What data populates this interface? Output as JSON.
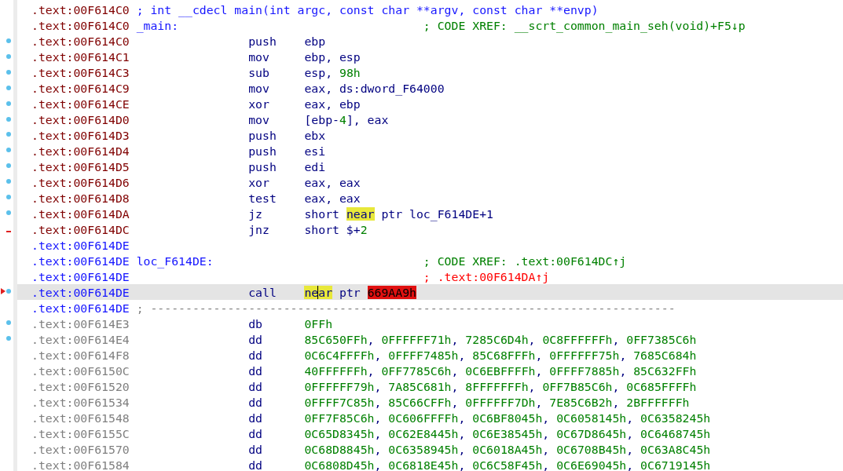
{
  "lines": [
    {
      "address": ".text:00F614C0",
      "kind": "code",
      "selected": false,
      "comment": {
        "text": "; int __cdecl main(int argc, const char **argv, const char **envp)",
        "kind": "prototype"
      }
    },
    {
      "address": ".text:00F614C0",
      "kind": "code",
      "selected": false,
      "label": "_main:",
      "comment": {
        "text": "; CODE XREF: __scrt_common_main_seh(void)+F5↓p",
        "kind": "xref"
      }
    },
    {
      "address": ".text:00F614C0",
      "kind": "code",
      "gutter": {
        "kind": "dot"
      },
      "selected": false,
      "mnemonic": "push",
      "operands": [
        {
          "text": "ebp",
          "kind": "plain"
        }
      ]
    },
    {
      "address": ".text:00F614C1",
      "kind": "code",
      "gutter": {
        "kind": "dot"
      },
      "selected": false,
      "mnemonic": "mov",
      "operands": [
        {
          "text": "ebp, esp",
          "kind": "plain"
        }
      ]
    },
    {
      "address": ".text:00F614C3",
      "kind": "code",
      "gutter": {
        "kind": "dot"
      },
      "selected": false,
      "mnemonic": "sub",
      "operands": [
        {
          "text": "esp, ",
          "kind": "plain"
        },
        {
          "text": "98h",
          "kind": "number"
        }
      ]
    },
    {
      "address": ".text:00F614C9",
      "kind": "code",
      "gutter": {
        "kind": "dot"
      },
      "selected": false,
      "mnemonic": "mov",
      "operands": [
        {
          "text": "eax, ds:dword_F64000",
          "kind": "plain"
        }
      ]
    },
    {
      "address": ".text:00F614CE",
      "kind": "code",
      "gutter": {
        "kind": "dot"
      },
      "selected": false,
      "mnemonic": "xor",
      "operands": [
        {
          "text": "eax, ebp",
          "kind": "plain"
        }
      ]
    },
    {
      "address": ".text:00F614D0",
      "kind": "code",
      "gutter": {
        "kind": "dot"
      },
      "selected": false,
      "mnemonic": "mov",
      "operands": [
        {
          "text": "[ebp-",
          "kind": "plain"
        },
        {
          "text": "4",
          "kind": "number"
        },
        {
          "text": "], eax",
          "kind": "plain"
        }
      ]
    },
    {
      "address": ".text:00F614D3",
      "kind": "code",
      "gutter": {
        "kind": "dot"
      },
      "selected": false,
      "mnemonic": "push",
      "operands": [
        {
          "text": "ebx",
          "kind": "plain"
        }
      ]
    },
    {
      "address": ".text:00F614D4",
      "kind": "code",
      "gutter": {
        "kind": "dot"
      },
      "selected": false,
      "mnemonic": "push",
      "operands": [
        {
          "text": "esi",
          "kind": "plain"
        }
      ]
    },
    {
      "address": ".text:00F614D5",
      "kind": "code",
      "gutter": {
        "kind": "dot"
      },
      "selected": false,
      "mnemonic": "push",
      "operands": [
        {
          "text": "edi",
          "kind": "plain"
        }
      ]
    },
    {
      "address": ".text:00F614D6",
      "kind": "code",
      "gutter": {
        "kind": "dot"
      },
      "selected": false,
      "mnemonic": "xor",
      "operands": [
        {
          "text": "eax, eax",
          "kind": "plain"
        }
      ]
    },
    {
      "address": ".text:00F614D8",
      "kind": "code",
      "gutter": {
        "kind": "dot"
      },
      "selected": false,
      "mnemonic": "test",
      "operands": [
        {
          "text": "eax, eax",
          "kind": "plain"
        }
      ]
    },
    {
      "address": ".text:00F614DA",
      "kind": "code",
      "gutter": {
        "kind": "dot"
      },
      "selected": false,
      "mnemonic": "jz",
      "operands": [
        {
          "text": "short",
          "kind": "plain"
        },
        {
          "text": "near",
          "kind": "highlight"
        },
        {
          "text": "ptr loc_F614DE+1",
          "kind": "plain"
        }
      ]
    },
    {
      "address": ".text:00F614DC",
      "kind": "code",
      "gutter": {
        "kind": "dash"
      },
      "selected": false,
      "mnemonic": "jnz",
      "operands": [
        {
          "text": "short $+",
          "kind": "plain"
        },
        {
          "text": "2",
          "kind": "number"
        }
      ]
    },
    {
      "address": ".text:00F614DE",
      "kind": "label",
      "selected": false
    },
    {
      "address": ".text:00F614DE",
      "kind": "label",
      "selected": false,
      "label": "loc_F614DE:",
      "comment": {
        "text": "; CODE XREF: .text:00F614DC↑j",
        "kind": "xref"
      }
    },
    {
      "address": ".text:00F614DE",
      "kind": "label",
      "selected": false,
      "comment": {
        "text": "; .text:00F614DA↑j",
        "kind": "bad_xref"
      }
    },
    {
      "address": ".text:00F614DE",
      "kind": "label",
      "gutter": {
        "kind": "arrow"
      },
      "selected": true,
      "mnemonic": "call",
      "operands": [
        {
          "text": "ne",
          "kind": "highlight",
          "caret_after": true
        },
        {
          "text": "ar",
          "kind": "highlight"
        },
        {
          "text": "ptr",
          "kind": "plain"
        },
        {
          "text": "669AA9h",
          "kind": "error"
        }
      ]
    },
    {
      "address": ".text:00F614DE",
      "kind": "label",
      "selected": false,
      "comment": {
        "text": "; ---------------------------------------------------------------------------",
        "kind": "separator"
      }
    },
    {
      "address": ".text:00F614E3",
      "kind": "data",
      "gutter": {
        "kind": "dot"
      },
      "selected": false,
      "mnemonic": "db",
      "operands": [
        {
          "text": "0FFh",
          "kind": "number"
        }
      ]
    },
    {
      "address": ".text:00F614E4",
      "kind": "data",
      "gutter": {
        "kind": "dot"
      },
      "selected": false,
      "mnemonic": "dd",
      "operands": [
        {
          "text": "85C650FFh",
          "kind": "number"
        },
        {
          "text": ", ",
          "kind": "plain"
        },
        {
          "text": "0FFFFFF71h",
          "kind": "number"
        },
        {
          "text": ", ",
          "kind": "plain"
        },
        {
          "text": "7285C6D4h",
          "kind": "number"
        },
        {
          "text": ", ",
          "kind": "plain"
        },
        {
          "text": "0C8FFFFFFh",
          "kind": "number"
        },
        {
          "text": ", ",
          "kind": "plain"
        },
        {
          "text": "0FF7385C6h",
          "kind": "number"
        }
      ]
    },
    {
      "address": ".text:00F614F8",
      "kind": "data",
      "selected": false,
      "mnemonic": "dd",
      "operands": [
        {
          "text": "0C6C4FFFFh",
          "kind": "number"
        },
        {
          "text": ", ",
          "kind": "plain"
        },
        {
          "text": "0FFFF7485h",
          "kind": "number"
        },
        {
          "text": ", ",
          "kind": "plain"
        },
        {
          "text": "85C68FFFh",
          "kind": "number"
        },
        {
          "text": ", ",
          "kind": "plain"
        },
        {
          "text": "0FFFFFF75h",
          "kind": "number"
        },
        {
          "text": ", ",
          "kind": "plain"
        },
        {
          "text": "7685C684h",
          "kind": "number"
        }
      ]
    },
    {
      "address": ".text:00F6150C",
      "kind": "data",
      "selected": false,
      "mnemonic": "dd",
      "operands": [
        {
          "text": "40FFFFFFh",
          "kind": "number"
        },
        {
          "text": ", ",
          "kind": "plain"
        },
        {
          "text": "0FF7785C6h",
          "kind": "number"
        },
        {
          "text": ", ",
          "kind": "plain"
        },
        {
          "text": "0C6EBFFFFh",
          "kind": "number"
        },
        {
          "text": ", ",
          "kind": "plain"
        },
        {
          "text": "0FFFF7885h",
          "kind": "number"
        },
        {
          "text": ", ",
          "kind": "plain"
        },
        {
          "text": "85C632FFh",
          "kind": "number"
        }
      ]
    },
    {
      "address": ".text:00F61520",
      "kind": "data",
      "selected": false,
      "mnemonic": "dd",
      "operands": [
        {
          "text": "0FFFFFF79h",
          "kind": "number"
        },
        {
          "text": ", ",
          "kind": "plain"
        },
        {
          "text": "7A85C681h",
          "kind": "number"
        },
        {
          "text": ", ",
          "kind": "plain"
        },
        {
          "text": "8FFFFFFFh",
          "kind": "number"
        },
        {
          "text": ", ",
          "kind": "plain"
        },
        {
          "text": "0FF7B85C6h",
          "kind": "number"
        },
        {
          "text": ", ",
          "kind": "plain"
        },
        {
          "text": "0C685FFFFh",
          "kind": "number"
        }
      ]
    },
    {
      "address": ".text:00F61534",
      "kind": "data",
      "selected": false,
      "mnemonic": "dd",
      "operands": [
        {
          "text": "0FFFF7C85h",
          "kind": "number"
        },
        {
          "text": ", ",
          "kind": "plain"
        },
        {
          "text": "85C66CFFh",
          "kind": "number"
        },
        {
          "text": ", ",
          "kind": "plain"
        },
        {
          "text": "0FFFFFF7Dh",
          "kind": "number"
        },
        {
          "text": ", ",
          "kind": "plain"
        },
        {
          "text": "7E85C6B2h",
          "kind": "number"
        },
        {
          "text": ", ",
          "kind": "plain"
        },
        {
          "text": "2BFFFFFFh",
          "kind": "number"
        }
      ]
    },
    {
      "address": ".text:00F61548",
      "kind": "data",
      "selected": false,
      "mnemonic": "dd",
      "operands": [
        {
          "text": "0FF7F85C6h",
          "kind": "number"
        },
        {
          "text": ", ",
          "kind": "plain"
        },
        {
          "text": "0C606FFFFh",
          "kind": "number"
        },
        {
          "text": ", ",
          "kind": "plain"
        },
        {
          "text": "0C6BF8045h",
          "kind": "number"
        },
        {
          "text": ", ",
          "kind": "plain"
        },
        {
          "text": "0C6058145h",
          "kind": "number"
        },
        {
          "text": ", ",
          "kind": "plain"
        },
        {
          "text": "0C6358245h",
          "kind": "number"
        }
      ]
    },
    {
      "address": ".text:00F6155C",
      "kind": "data",
      "selected": false,
      "mnemonic": "dd",
      "operands": [
        {
          "text": "0C65D8345h",
          "kind": "number"
        },
        {
          "text": ", ",
          "kind": "plain"
        },
        {
          "text": "0C62E8445h",
          "kind": "number"
        },
        {
          "text": ", ",
          "kind": "plain"
        },
        {
          "text": "0C6E38545h",
          "kind": "number"
        },
        {
          "text": ", ",
          "kind": "plain"
        },
        {
          "text": "0C67D8645h",
          "kind": "number"
        },
        {
          "text": ", ",
          "kind": "plain"
        },
        {
          "text": "0C6468745h",
          "kind": "number"
        }
      ]
    },
    {
      "address": ".text:00F61570",
      "kind": "data",
      "selected": false,
      "mnemonic": "dd",
      "operands": [
        {
          "text": "0C68D8845h",
          "kind": "number"
        },
        {
          "text": ", ",
          "kind": "plain"
        },
        {
          "text": "0C6358945h",
          "kind": "number"
        },
        {
          "text": ", ",
          "kind": "plain"
        },
        {
          "text": "0C6018A45h",
          "kind": "number"
        },
        {
          "text": ", ",
          "kind": "plain"
        },
        {
          "text": "0C6708B45h",
          "kind": "number"
        },
        {
          "text": ", ",
          "kind": "plain"
        },
        {
          "text": "0C63A8C45h",
          "kind": "number"
        }
      ]
    },
    {
      "address": ".text:00F61584",
      "kind": "data",
      "selected": false,
      "mnemonic": "dd",
      "operands": [
        {
          "text": "0C6808D45h",
          "kind": "number"
        },
        {
          "text": ", ",
          "kind": "plain"
        },
        {
          "text": "0C6818E45h",
          "kind": "number"
        },
        {
          "text": ", ",
          "kind": "plain"
        },
        {
          "text": "0C6C58F45h",
          "kind": "number"
        },
        {
          "text": ", ",
          "kind": "plain"
        },
        {
          "text": "0C6E69045h",
          "kind": "number"
        },
        {
          "text": ", ",
          "kind": "plain"
        },
        {
          "text": "0C6719145h",
          "kind": "number"
        }
      ]
    }
  ]
}
